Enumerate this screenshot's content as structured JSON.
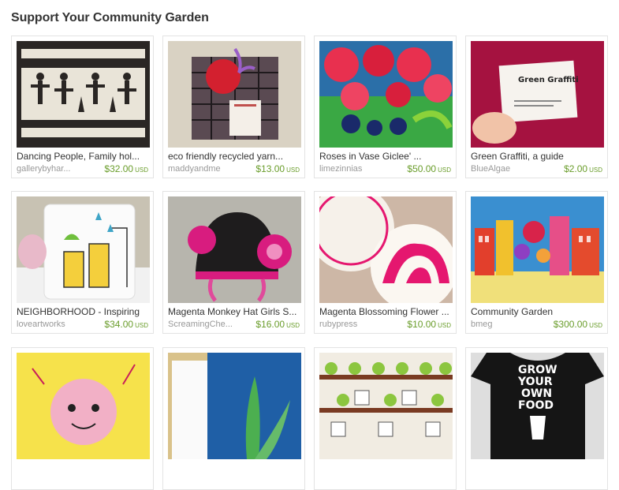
{
  "page": {
    "title": "Support Your Community Garden"
  },
  "items": [
    {
      "name": "Dancing People, Family hol...",
      "shop": "gallerybyhar...",
      "price": "$32.00",
      "currency": "USD",
      "image": "paper-cut-dancing-people"
    },
    {
      "name": "eco friendly recycled yarn...",
      "shop": "maddyandme",
      "price": "$13.00",
      "currency": "USD",
      "image": "yarn-cage-red-bird"
    },
    {
      "name": "Roses in Vase Giclee' ...",
      "shop": "limezinnias",
      "price": "$50.00",
      "currency": "USD",
      "image": "colorful-roses-painting"
    },
    {
      "name": "Green Graffiti, a guide",
      "shop": "BlueAlgae",
      "price": "$2.00",
      "currency": "USD",
      "image": "green-graffiti-card",
      "card_text": "Green Graffiti"
    },
    {
      "name": "NEIGHBORHOOD - Inspiring",
      "shop": "loveartworks",
      "price": "$34.00",
      "currency": "USD",
      "image": "painted-mug"
    },
    {
      "name": "Magenta Monkey Hat Girls S...",
      "shop": "ScreamingChe...",
      "price": "$16.00",
      "currency": "USD",
      "image": "crochet-monkey-hat"
    },
    {
      "name": "Magenta Blossoming Flower ...",
      "shop": "rubypress",
      "price": "$10.00",
      "currency": "USD",
      "image": "letterpress-coasters"
    },
    {
      "name": "Community Garden",
      "shop": "bmeg",
      "price": "$300.00",
      "currency": "USD",
      "image": "colorful-city-painting"
    },
    {
      "name": "",
      "shop": "",
      "price": "",
      "currency": "",
      "image": "yellow-doodle-art"
    },
    {
      "name": "",
      "shop": "",
      "price": "",
      "currency": "",
      "image": "plant-leaf-painting"
    },
    {
      "name": "",
      "shop": "",
      "price": "",
      "currency": "",
      "image": "houses-trees-print"
    },
    {
      "name": "",
      "shop": "",
      "price": "",
      "currency": "",
      "image": "grow-your-own-food-tshirt",
      "shirt_text": [
        "GROW",
        "YOUR",
        "OWN",
        "FOOD"
      ]
    }
  ]
}
